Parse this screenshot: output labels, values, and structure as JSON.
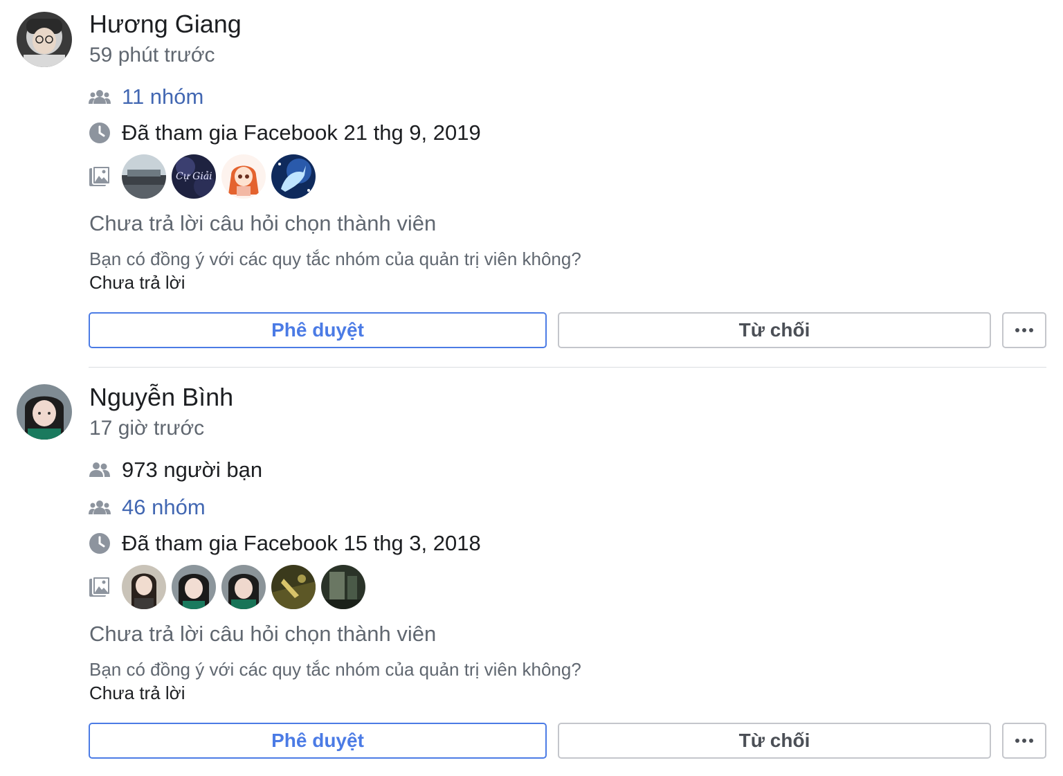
{
  "requests": [
    {
      "name": "Hương Giang",
      "time": "59 phút trước",
      "groups": "11 nhóm",
      "joined": "Đã tham gia Facebook 21 thg 9, 2019",
      "question_status": "Chưa trả lời câu hỏi chọn thành viên",
      "question": "Bạn có đồng ý với các quy tắc nhóm của quản trị viên không?",
      "answer": "Chưa trả lời",
      "approve_label": "Phê duyệt",
      "decline_label": "Từ chối",
      "photos": [
        "group-photo",
        "cu-giai-photo",
        "anime-girl-photo",
        "unicorn-photo"
      ]
    },
    {
      "name": "Nguyễn Bình",
      "time": "17 giờ trước",
      "friends": "973 người bạn",
      "groups": "46 nhóm",
      "joined": "Đã tham gia Facebook 15 thg 3, 2018",
      "question_status": "Chưa trả lời câu hỏi chọn thành viên",
      "question": "Bạn có đồng ý với các quy tắc nhóm của quản trị viên không?",
      "answer": "Chưa trả lời",
      "approve_label": "Phê duyệt",
      "decline_label": "Từ chối",
      "photos": [
        "selfie-photo-1",
        "selfie-photo-2",
        "selfie-photo-3",
        "outdoor-photo",
        "dark-photo"
      ]
    }
  ],
  "colors": {
    "link": "#4267b2",
    "approve": "#4b7be5",
    "secondary_text": "#606770",
    "icon": "#8d949e"
  }
}
